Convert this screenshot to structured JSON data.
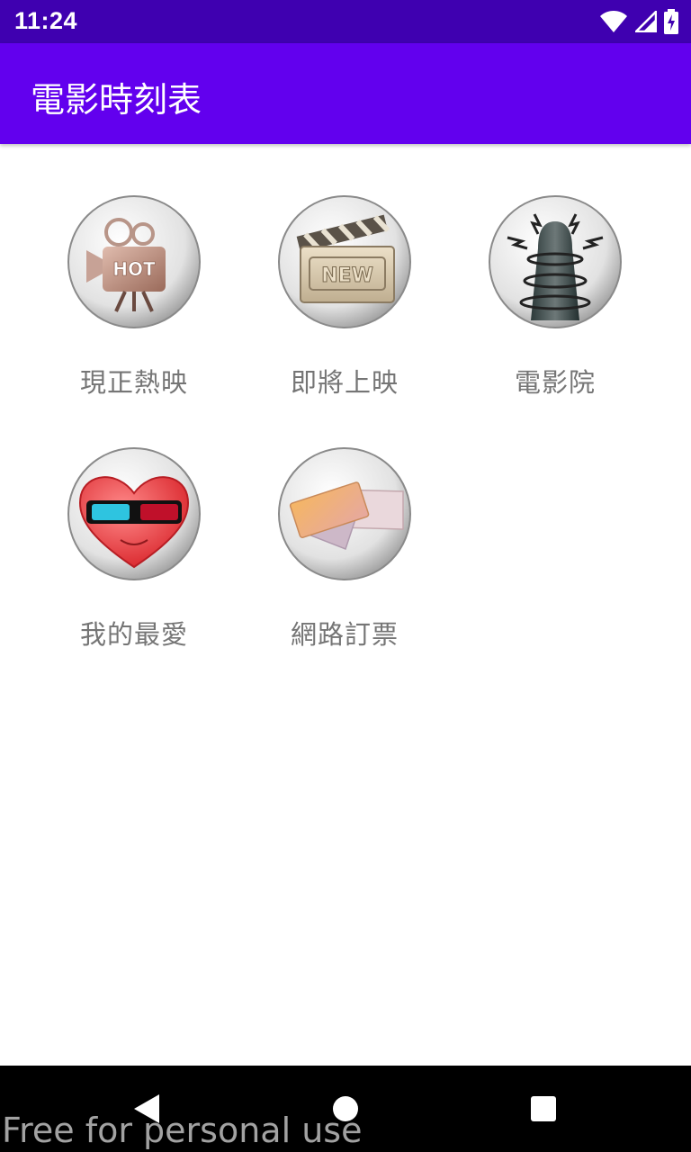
{
  "status_bar": {
    "time": "11:24",
    "icons": [
      "wifi-icon",
      "signal-icon",
      "battery-icon"
    ]
  },
  "app_bar": {
    "title": "電影時刻表",
    "color": "#6200ee"
  },
  "menu": {
    "items": [
      {
        "label": "現正熱映",
        "icon": "hot-movie-camera-icon",
        "badge": "HOT"
      },
      {
        "label": "即將上映",
        "icon": "new-clapperboard-icon",
        "badge": "NEW"
      },
      {
        "label": "電影院",
        "icon": "cinema-tower-icon"
      },
      {
        "label": "我的最愛",
        "icon": "heart-3d-glasses-icon"
      },
      {
        "label": "網路訂票",
        "icon": "tickets-icon"
      }
    ]
  },
  "nav_bar": {
    "buttons": [
      "back-icon",
      "home-icon",
      "recents-icon"
    ]
  },
  "watermark": "Free for personal use"
}
